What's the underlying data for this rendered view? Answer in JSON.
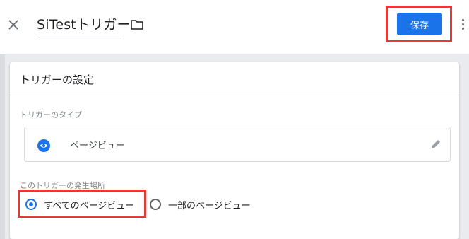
{
  "header": {
    "title": "SiTestトリガー",
    "save_label": "保存",
    "close_icon": "close-icon",
    "folder_icon": "folder-icon",
    "more_icon": "more-vert-icon"
  },
  "card": {
    "title": "トリガーの設定",
    "type_section_label": "トリガーのタイプ",
    "trigger_type": "ページビュー",
    "trigger_type_icon": "eye-icon",
    "edit_icon": "pencil-icon",
    "where_section_label": "このトリガーの発生場所",
    "options": [
      {
        "label": "すべてのページビュー",
        "selected": true
      },
      {
        "label": "一部のページビュー",
        "selected": false
      }
    ]
  },
  "colors": {
    "accent": "#1a73e8",
    "highlight": "#e53935"
  }
}
